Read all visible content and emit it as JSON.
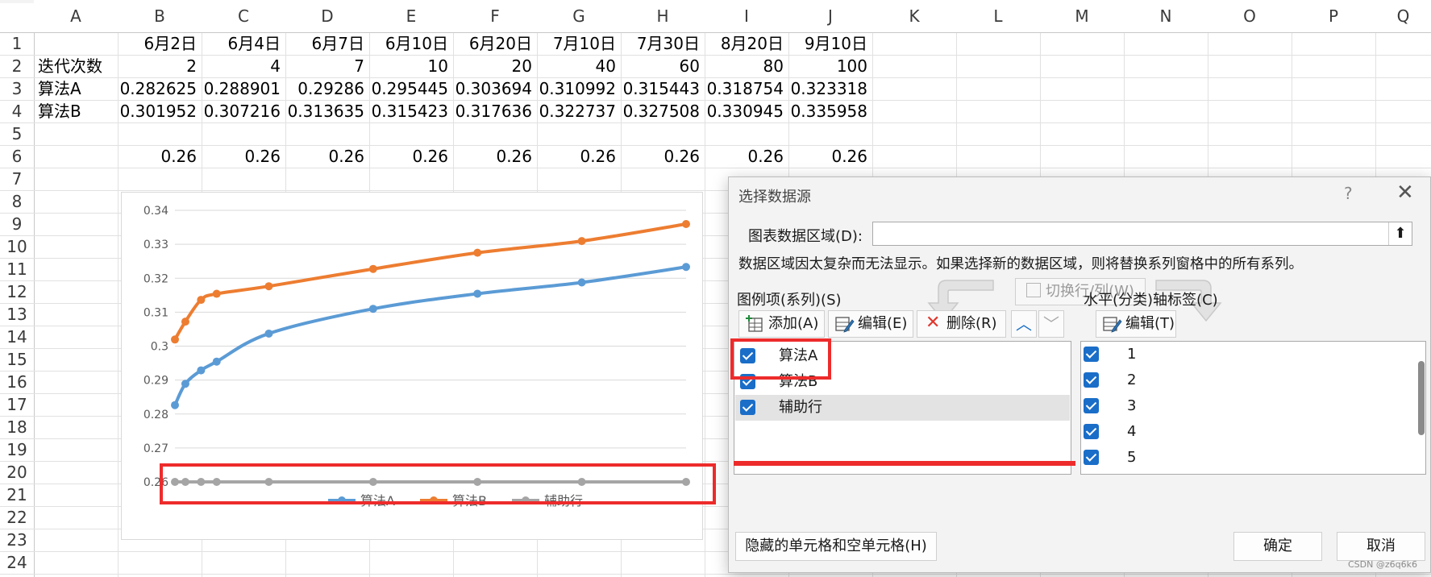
{
  "spreadsheet": {
    "columns": [
      "A",
      "B",
      "C",
      "D",
      "E",
      "F",
      "G",
      "H",
      "I",
      "J",
      "K",
      "L",
      "M",
      "N",
      "O",
      "P",
      "Q"
    ],
    "rows": [
      "1",
      "2",
      "3",
      "4",
      "5",
      "6",
      "7",
      "8",
      "9",
      "10",
      "11",
      "12",
      "13",
      "14",
      "15",
      "16",
      "17",
      "18",
      "19",
      "20",
      "21",
      "22",
      "23",
      "24"
    ],
    "row1": {
      "B": "6月2日",
      "C": "6月4日",
      "D": "6月7日",
      "E": "6月10日",
      "F": "6月20日",
      "G": "7月10日",
      "H": "7月30日",
      "I": "8月20日",
      "J": "9月10日"
    },
    "row2": {
      "A": "迭代次数",
      "B": "2",
      "C": "4",
      "D": "7",
      "E": "10",
      "F": "20",
      "G": "40",
      "H": "60",
      "I": "80",
      "J": "100"
    },
    "row3": {
      "A": "算法A",
      "B": "0.282625",
      "C": "0.288901",
      "D": "0.29286",
      "E": "0.295445",
      "F": "0.303694",
      "G": "0.310992",
      "H": "0.315443",
      "I": "0.318754",
      "J": "0.323318"
    },
    "row4": {
      "A": "算法B",
      "B": "0.301952",
      "C": "0.307216",
      "D": "0.313635",
      "E": "0.315423",
      "F": "0.317636",
      "G": "0.322737",
      "H": "0.327508",
      "I": "0.330945",
      "J": "0.335958"
    },
    "row6": {
      "B": "0.26",
      "C": "0.26",
      "D": "0.26",
      "E": "0.26",
      "F": "0.26",
      "G": "0.26",
      "H": "0.26",
      "I": "0.26",
      "J": "0.26"
    }
  },
  "chart_data": {
    "type": "scatter",
    "x": [
      2,
      4,
      7,
      10,
      20,
      40,
      60,
      80,
      100
    ],
    "series": [
      {
        "name": "算法A",
        "color": "#5b9bd5",
        "values": [
          0.282625,
          0.288901,
          0.29286,
          0.295445,
          0.303694,
          0.310992,
          0.315443,
          0.318754,
          0.323318
        ]
      },
      {
        "name": "算法B",
        "color": "#ed7d31",
        "values": [
          0.301952,
          0.307216,
          0.313635,
          0.315423,
          0.317636,
          0.322737,
          0.327508,
          0.330945,
          0.335958
        ]
      },
      {
        "name": "辅助行",
        "color": "#a5a5a5",
        "values": [
          0.26,
          0.26,
          0.26,
          0.26,
          0.26,
          0.26,
          0.26,
          0.26,
          0.26
        ]
      }
    ],
    "xlim": [
      2,
      100
    ],
    "ylim": [
      0.26,
      0.34
    ],
    "yticks": [
      "0.34",
      "0.33",
      "0.32",
      "0.31",
      "0.3",
      "0.29",
      "0.28",
      "0.27",
      "0.26"
    ],
    "grid": true,
    "legend": "bottom",
    "markers": true,
    "smooth_lines": true
  },
  "dialog": {
    "title": "选择数据源",
    "help": "?",
    "close": "✕",
    "range_label": "图表数据区域(D):",
    "range_value": "",
    "range_collapse": "⬆",
    "warning": "数据区域因太复杂而无法显示。如果选择新的数据区域，则将替换系列窗格中的所有系列。",
    "switch_label": "切换行/列(W)",
    "series_header": "图例项(系列)(S)",
    "add_label": "添加(A)",
    "edit_label": "编辑(E)",
    "delete_label": "删除(R)",
    "series_items": [
      "算法A",
      "算法B",
      "辅助行"
    ],
    "axis_header": "水平(分类)轴标签(C)",
    "axis_edit_label": "编辑(T)",
    "axis_items": [
      "1",
      "2",
      "3",
      "4",
      "5"
    ],
    "hidden_cells_label": "隐藏的单元格和空单元格(H)",
    "ok_label": "确定",
    "cancel_label": "取消"
  },
  "watermark": "CSDN @z6q6k6"
}
